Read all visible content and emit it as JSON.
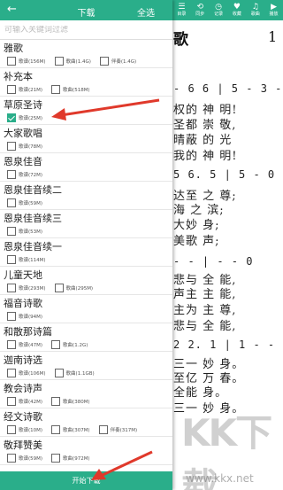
{
  "panel": {
    "title": "下载",
    "select_all": "全选",
    "search_placeholder": "可输入关键词过滤",
    "start_button": "开始下载",
    "groups": [
      {
        "title": "雅歌",
        "options": [
          {
            "label": "歌谱(156M)",
            "checked": false
          },
          {
            "label": "歌曲(1.4G)",
            "checked": false
          },
          {
            "label": "伴奏(1.4G)",
            "checked": false
          }
        ]
      },
      {
        "title": "补充本",
        "options": [
          {
            "label": "歌谱(21M)",
            "checked": false
          },
          {
            "label": "歌曲(518M)",
            "checked": false
          }
        ]
      },
      {
        "title": "草原圣诗",
        "options": [
          {
            "label": "歌谱(25M)",
            "checked": true
          }
        ]
      },
      {
        "title": "大家歌唱",
        "options": [
          {
            "label": "歌谱(78M)",
            "checked": false
          }
        ]
      },
      {
        "title": "恩泉佳音",
        "options": [
          {
            "label": "歌谱(72M)",
            "checked": false
          }
        ]
      },
      {
        "title": "恩泉佳音续二",
        "options": [
          {
            "label": "歌谱(59M)",
            "checked": false
          }
        ]
      },
      {
        "title": "恩泉佳音续三",
        "options": [
          {
            "label": "歌谱(53M)",
            "checked": false
          }
        ]
      },
      {
        "title": "恩泉佳音续一",
        "options": [
          {
            "label": "歌谱(114M)",
            "checked": false
          }
        ]
      },
      {
        "title": "儿童天地",
        "options": [
          {
            "label": "歌谱(293M)",
            "checked": false
          },
          {
            "label": "歌曲(295M)",
            "checked": false
          }
        ]
      },
      {
        "title": "福音诗歌",
        "options": [
          {
            "label": "歌谱(94M)",
            "checked": false
          }
        ]
      },
      {
        "title": "和散那诗篇",
        "options": [
          {
            "label": "歌谱(47M)",
            "checked": false
          },
          {
            "label": "歌曲(1.2G)",
            "checked": false
          }
        ]
      },
      {
        "title": "迦南诗选",
        "options": [
          {
            "label": "歌谱(106M)",
            "checked": false
          },
          {
            "label": "歌曲(1.1GB)",
            "checked": false
          }
        ]
      },
      {
        "title": "教会诗声",
        "options": [
          {
            "label": "歌谱(42M)",
            "checked": false
          },
          {
            "label": "歌曲(380M)",
            "checked": false
          }
        ]
      },
      {
        "title": "经文诗歌",
        "options": [
          {
            "label": "歌谱(10M)",
            "checked": false
          },
          {
            "label": "歌曲(307M)",
            "checked": false
          },
          {
            "label": "伴奏(317M)",
            "checked": false
          }
        ]
      },
      {
        "title": "敬拜赞美",
        "options": [
          {
            "label": "歌谱(59M)",
            "checked": false
          },
          {
            "label": "歌曲(972M)",
            "checked": false
          }
        ]
      }
    ]
  },
  "viewer": {
    "tools": [
      {
        "icon": "list-icon",
        "glyph": "☰",
        "label": "目录"
      },
      {
        "icon": "sync-icon",
        "glyph": "⟲",
        "label": "同步"
      },
      {
        "icon": "history-icon",
        "glyph": "◷",
        "label": "记录"
      },
      {
        "icon": "favorite-icon",
        "glyph": "♥",
        "label": "收藏"
      },
      {
        "icon": "music-icon",
        "glyph": "♫",
        "label": "歌曲"
      },
      {
        "icon": "play-icon",
        "glyph": "▶",
        "label": "播放"
      }
    ],
    "title": "歌",
    "number": "1",
    "lines": [
      {
        "text": "- 6 6 | 5 - 3 -",
        "num": true
      },
      {
        "text": "权的 神 明!",
        "num": false
      },
      {
        "text": "圣都 崇 敬,",
        "num": false
      },
      {
        "text": "晴蔽 的 光",
        "num": false
      },
      {
        "text": "我的 神 明!",
        "num": false
      },
      {
        "text": "5 6. 5 | 5 - 0",
        "num": true
      },
      {
        "text": "达至 之 尊;",
        "num": false
      },
      {
        "text": "海 之 滨;",
        "num": false
      },
      {
        "text": "大妙 身;",
        "num": false
      },
      {
        "text": "美歌 声;",
        "num": false
      },
      {
        "text": "- - | - - 0",
        "num": true
      },
      {
        "text": "悲与 全 能,",
        "num": false
      },
      {
        "text": "声主 主 能,",
        "num": false
      },
      {
        "text": "主为 主 尊,",
        "num": false
      },
      {
        "text": "悲与 全 能,",
        "num": false
      },
      {
        "text": "2 2. 1 | 1 - -",
        "num": true
      },
      {
        "text": "三一 妙 身。",
        "num": false
      },
      {
        "text": "至亿 万 春。",
        "num": false
      },
      {
        "text": "全能 身。",
        "num": false
      },
      {
        "text": "三一 妙 身。",
        "num": false
      }
    ]
  },
  "watermark": {
    "big": "KK下载",
    "url": "www.kkx.net"
  },
  "colors": {
    "accent": "#2aae8a",
    "annotation_arrow": "#e0392b"
  }
}
